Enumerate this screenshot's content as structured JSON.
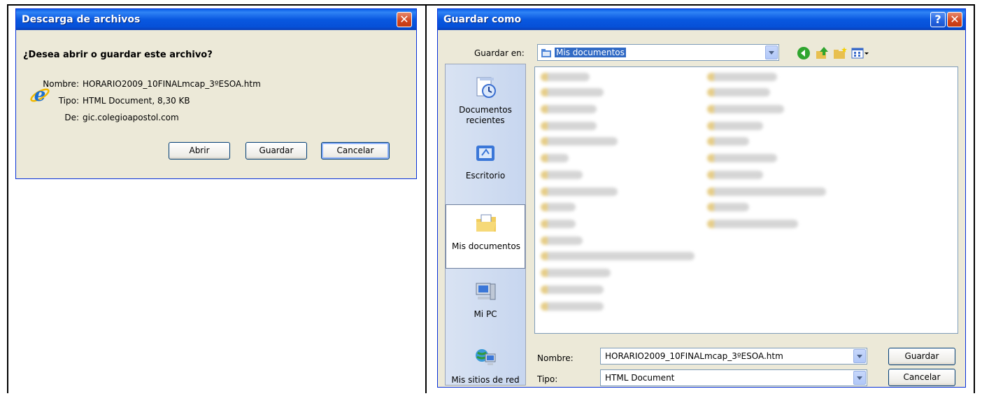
{
  "download_dialog": {
    "title": "Descarga de archivos",
    "question": "¿Desea abrir o guardar este archivo?",
    "name_label": "Nombre:",
    "name_value": "HORARIO2009_10FINALmcap_3ºESOA.htm",
    "type_label": "Tipo:",
    "type_value": "HTML Document, 8,30 KB",
    "from_label": "De:",
    "from_value": "gic.colegioapostol.com",
    "open_button": "Abrir",
    "save_button": "Guardar",
    "cancel_button": "Cancelar"
  },
  "save_dialog": {
    "title": "Guardar como",
    "help_glyph": "?",
    "save_in_label": "Guardar en:",
    "save_in_value": "Mis documentos",
    "places": [
      {
        "label": "Documentos recientes",
        "icon": "recent-documents-icon"
      },
      {
        "label": "Escritorio",
        "icon": "desktop-icon"
      },
      {
        "label": "Mis documentos",
        "icon": "my-documents-icon",
        "active": true
      },
      {
        "label": "Mi PC",
        "icon": "my-computer-icon"
      },
      {
        "label": "Mis sitios de red",
        "icon": "network-places-icon"
      }
    ],
    "filename_label": "Nombre:",
    "filename_value": "HORARIO2009_10FINALmcap_3ºESOA.htm",
    "filetype_label": "Tipo:",
    "filetype_value": "HTML Document",
    "save_button": "Guardar",
    "cancel_button": "Cancelar"
  },
  "colors": {
    "titlebar": "#0a5fe8",
    "dialog_bg": "#ece9d8",
    "selection": "#316ac5",
    "close_button": "#d2431c"
  }
}
